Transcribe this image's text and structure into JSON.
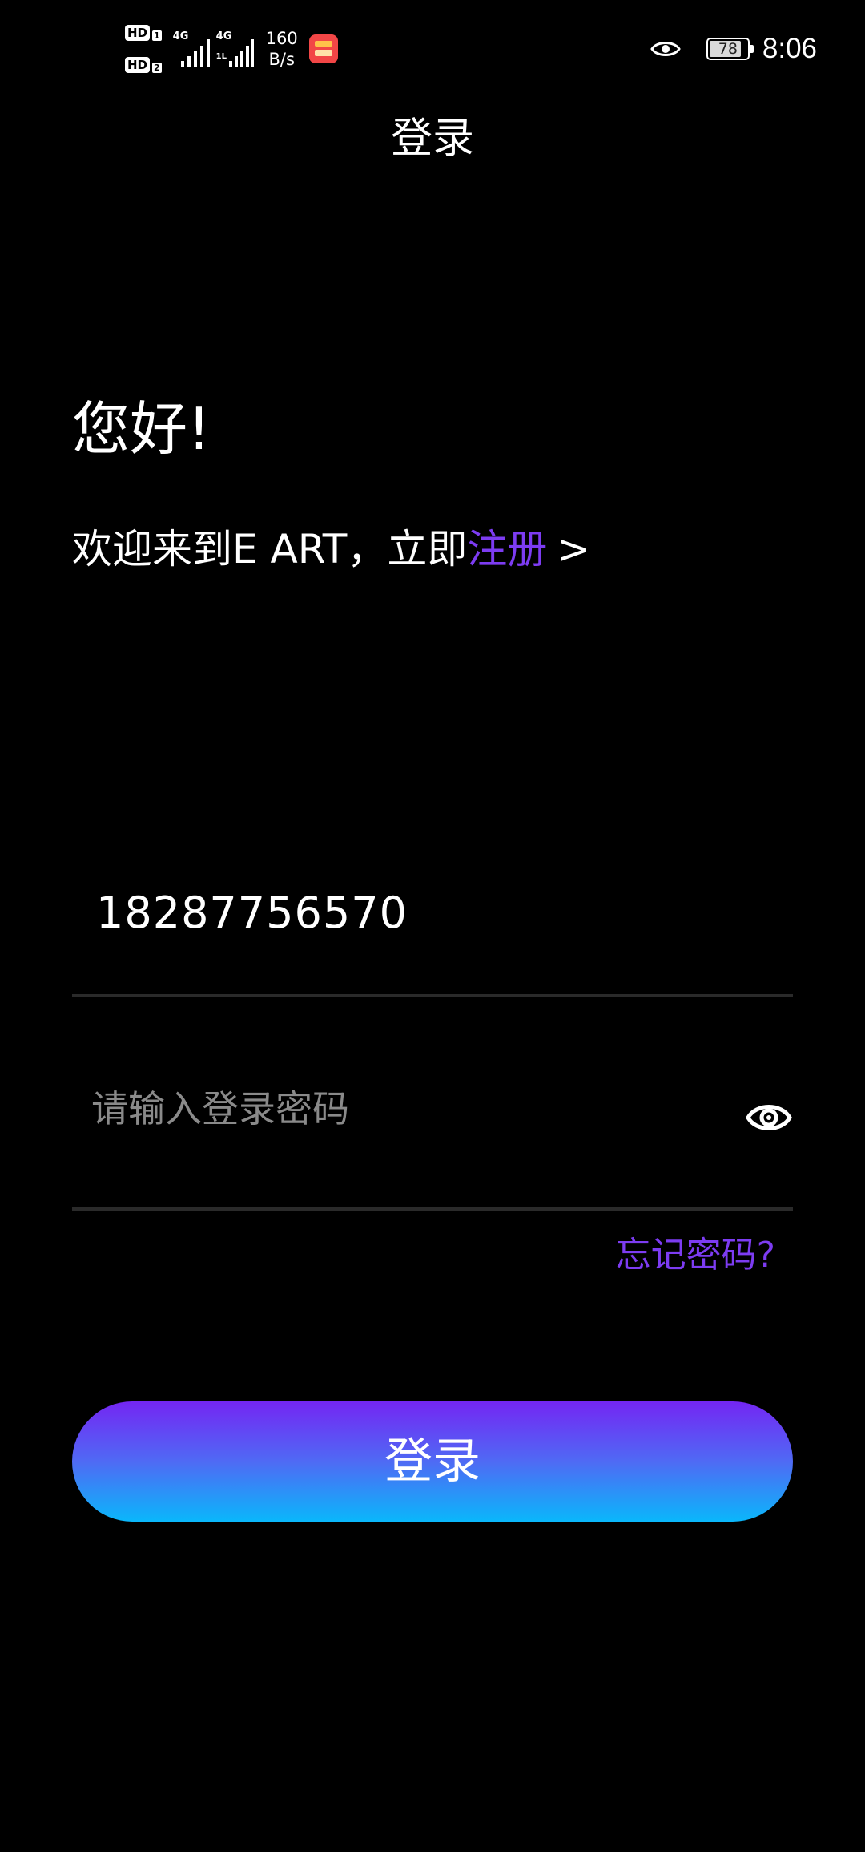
{
  "status_bar": {
    "hd1": "HD",
    "hd1_sub": "1",
    "hd2": "HD",
    "hd2_sub": "2",
    "network1": "4G",
    "network2": "4G",
    "network2_sub": "1L",
    "speed_value": "160",
    "speed_unit": "B/s",
    "battery_level": "78",
    "time": "8:06"
  },
  "header": {
    "title": "登录"
  },
  "greeting": {
    "hello": "您好!",
    "welcome_prefix": "欢迎来到E ART，立即",
    "register_link": "注册",
    "register_arrow": ">"
  },
  "form": {
    "phone_value": "18287756570",
    "password_placeholder": "请输入登录密码",
    "password_value": "",
    "forgot_label": "忘记密码?",
    "login_label": "登录"
  },
  "colors": {
    "background": "#000000",
    "accent_purple": "#7d3cf2",
    "button_gradient_top": "#7426f3",
    "button_gradient_bottom": "#0ab7fb"
  },
  "icons": {
    "eye_status": "eye-icon",
    "password_toggle": "eye-icon"
  }
}
